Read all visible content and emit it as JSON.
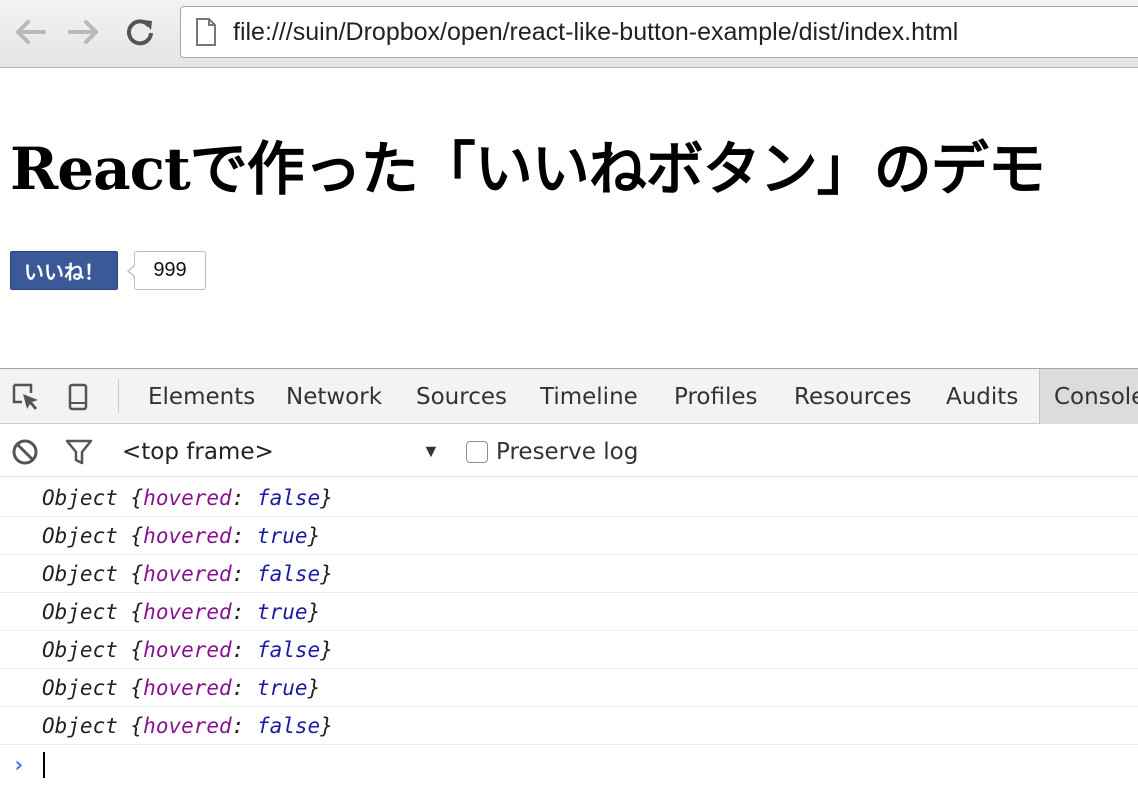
{
  "browser": {
    "url": "file:///suin/Dropbox/open/react-like-button-example/dist/index.html",
    "icons": [
      "back-arrow-icon",
      "forward-arrow-icon",
      "reload-icon",
      "page-icon"
    ]
  },
  "page": {
    "title": "Reactで作った「いいねボタン」のデモ",
    "like_button_label": "いいね！",
    "like_count": "999",
    "colors": {
      "like_button": "#3b5998"
    }
  },
  "devtools": {
    "tabs": [
      {
        "label": "Elements"
      },
      {
        "label": "Network"
      },
      {
        "label": "Sources"
      },
      {
        "label": "Timeline"
      },
      {
        "label": "Profiles"
      },
      {
        "label": "Resources"
      },
      {
        "label": "Audits"
      },
      {
        "label": "Console"
      }
    ],
    "active_tab": "Console",
    "icons": [
      "inspect-element-icon",
      "device-mode-icon",
      "clear-console-icon",
      "filter-icon"
    ],
    "console": {
      "frame_select": "<top frame>",
      "preserve_log_label": "Preserve log",
      "preserve_log_checked": false,
      "logs": [
        {
          "prefix": "Object ",
          "key": "hovered",
          "value": "false"
        },
        {
          "prefix": "Object ",
          "key": "hovered",
          "value": "true"
        },
        {
          "prefix": "Object ",
          "key": "hovered",
          "value": "false"
        },
        {
          "prefix": "Object ",
          "key": "hovered",
          "value": "true"
        },
        {
          "prefix": "Object ",
          "key": "hovered",
          "value": "false"
        },
        {
          "prefix": "Object ",
          "key": "hovered",
          "value": "true"
        },
        {
          "prefix": "Object ",
          "key": "hovered",
          "value": "false"
        }
      ],
      "prompt": "›",
      "colors": {
        "key": "#881391",
        "value": "#1a1aa6"
      }
    }
  }
}
